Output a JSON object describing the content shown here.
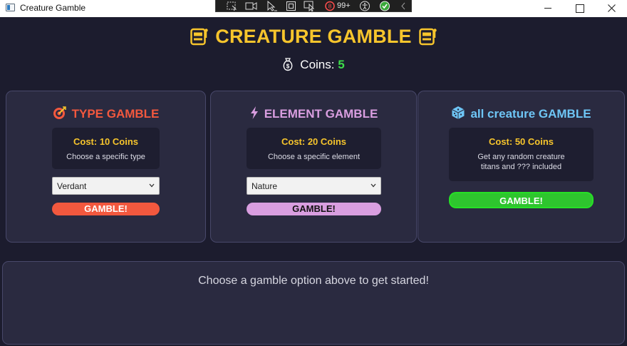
{
  "window": {
    "title": "Creature Gamble",
    "controls": [
      "minimize",
      "maximize",
      "close"
    ]
  },
  "overlay_toolbar": {
    "icons": [
      "select-region-icon",
      "record-icon",
      "pointer-icon",
      "crop-icon",
      "pointer-select-icon",
      "notifications-icon",
      "accessibility-icon",
      "check-icon",
      "collapse-icon"
    ],
    "notification_count": "99+"
  },
  "header": {
    "title": "CREATURE GAMBLE",
    "title_icon": "slot-machine-icon",
    "coins_label": "Coins:",
    "coins_value": "5",
    "coins_icon": "money-bag-icon"
  },
  "cards": {
    "type": {
      "title": "TYPE GAMBLE",
      "icon": "target-icon",
      "color": "#f2583e",
      "cost": "Cost: 10 Coins",
      "description": "Choose a specific type",
      "selected": "Verdant",
      "button": "GAMBLE!"
    },
    "element": {
      "title": "ELEMENT GAMBLE",
      "icon": "lightning-icon",
      "color": "#d99ee0",
      "cost": "Cost: 20 Coins",
      "description": "Choose a specific element",
      "selected": "Nature",
      "button": "GAMBLE!"
    },
    "all": {
      "title": "all creature GAMBLE",
      "icon": "dice-icon",
      "color": "#6ec5f5",
      "cost": "Cost: 50 Coins",
      "description_line1": "Get any random creature",
      "description_line2": "titans and ??? included",
      "button": "GAMBLE!"
    }
  },
  "result": {
    "message": "Choose a gamble option above to get started!"
  },
  "colors": {
    "background": "#1c1c2e",
    "panel": "#2a2a40",
    "accent_gold": "#f7c52c",
    "coin_green": "#3ddc4a",
    "button_green": "#2ec52e"
  }
}
